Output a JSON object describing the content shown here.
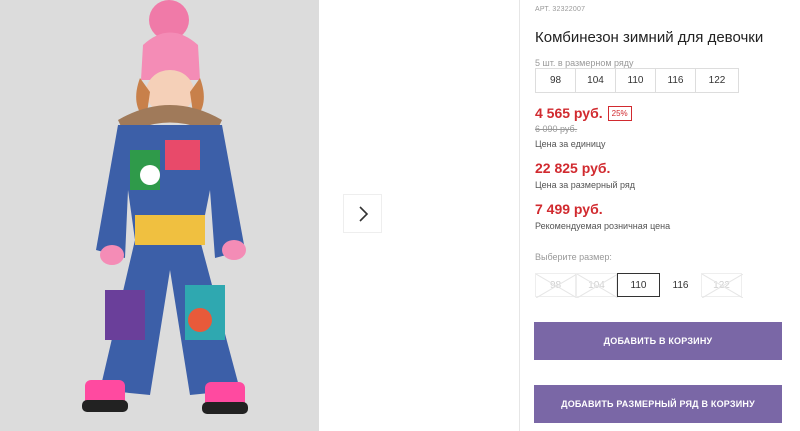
{
  "product": {
    "article": "АРТ. 32322007",
    "title": "Комбинезон зимний для девочки",
    "row_note": "5 шт. в размерном ряду",
    "row_sizes": [
      "98",
      "104",
      "110",
      "116",
      "122"
    ]
  },
  "prices": {
    "unit_price": "4 565 руб.",
    "discount": "25%",
    "old_price": "6 090 руб.",
    "unit_label": "Цена за единицу",
    "row_price": "22 825 руб.",
    "row_label": "Цена за размерный ряд",
    "retail_price": "7 499 руб.",
    "retail_label": "Рекомендуемая розничная цена"
  },
  "size_select": {
    "label": "Выберите размер:",
    "options": [
      {
        "label": "98",
        "state": "disabled"
      },
      {
        "label": "104",
        "state": "disabled"
      },
      {
        "label": "110",
        "state": "selected"
      },
      {
        "label": "116",
        "state": "available"
      },
      {
        "label": "122",
        "state": "disabled"
      }
    ]
  },
  "actions": {
    "add_to_cart": "ДОБАВИТЬ В КОРЗИНУ",
    "add_row_to_cart": "ДОБАВИТЬ РАЗМЕРНЫЙ РЯД В КОРЗИНУ"
  },
  "gallery": {
    "next_icon": "chevron-right-icon"
  },
  "colors": {
    "accent_button": "#7a67a6",
    "price_red": "#d12a2f"
  }
}
